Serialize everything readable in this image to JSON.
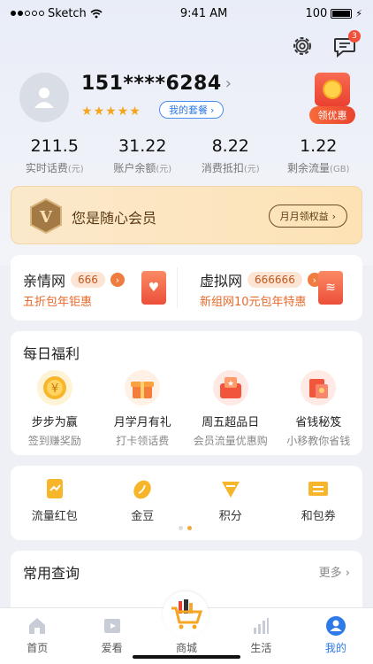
{
  "status_bar": {
    "carrier": "Sketch",
    "time": "9:41 AM",
    "battery": "100"
  },
  "header": {
    "message_count": "3"
  },
  "profile": {
    "phone": "151****6284",
    "chevron": "›",
    "rating_stars": 5,
    "package_button": "我的套餐",
    "coupon_label": "领优惠"
  },
  "stats": [
    {
      "value": "211.5",
      "label": "实时话费",
      "unit": "(元)"
    },
    {
      "value": "31.22",
      "label": "账户余额",
      "unit": "(元)"
    },
    {
      "value": "8.22",
      "label": "消费抵扣",
      "unit": "(元)"
    },
    {
      "value": "1.22",
      "label": "剩余流量",
      "unit": "(GB)"
    }
  ],
  "member": {
    "title": "您是随心会员",
    "button": "月月领权益"
  },
  "family": [
    {
      "title": "亲情网",
      "count": "666",
      "subtitle": "五折包年钜惠"
    },
    {
      "title": "虚拟网",
      "count": "666666",
      "subtitle": "新组网10元包年特惠"
    }
  ],
  "daily": {
    "title": "每日福利",
    "items": [
      {
        "name": "步步为赢",
        "sub": "签到赚奖励"
      },
      {
        "name": "月学月有礼",
        "sub": "打卡领话费"
      },
      {
        "name": "周五超品日",
        "sub": "会员流量优惠购"
      },
      {
        "name": "省钱秘笈",
        "sub": "小移教你省钱"
      }
    ]
  },
  "quick": [
    {
      "name": "流量红包"
    },
    {
      "name": "金豆"
    },
    {
      "name": "积分"
    },
    {
      "name": "和包券"
    }
  ],
  "common": {
    "title": "常用查询",
    "more": "更多 ›"
  },
  "tabbar": [
    {
      "label": "首页"
    },
    {
      "label": "爱看"
    },
    {
      "label": "商城"
    },
    {
      "label": "生活"
    },
    {
      "label": "我的"
    }
  ],
  "colors": {
    "accent": "#2d7ae8",
    "orange": "#e8692a",
    "gold": "#f0a93b"
  }
}
